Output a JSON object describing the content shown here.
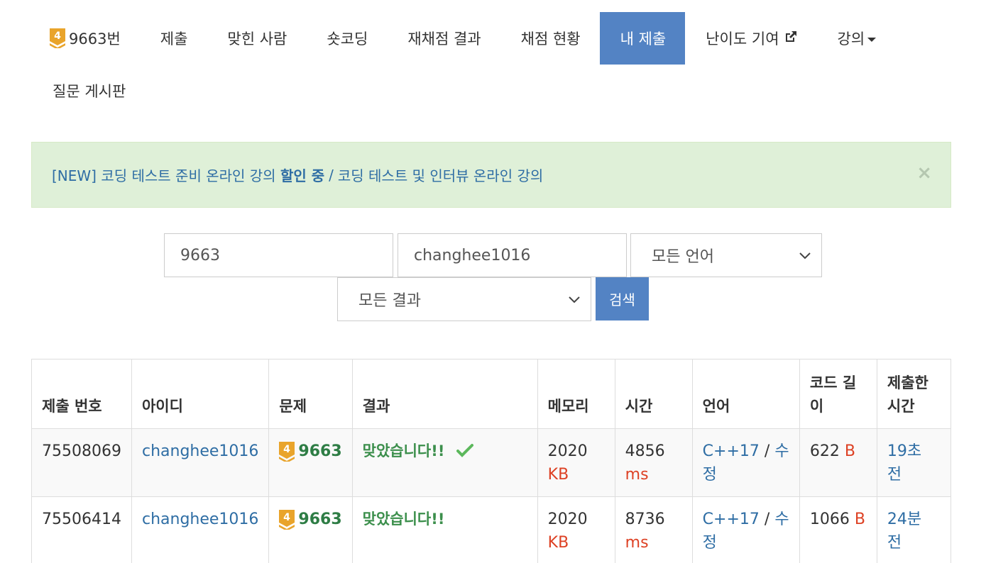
{
  "nav": {
    "problem": {
      "tier": "4",
      "label": "9663번"
    },
    "items": [
      {
        "label": "제출"
      },
      {
        "label": "맞힌 사람"
      },
      {
        "label": "숏코딩"
      },
      {
        "label": "재채점 결과"
      },
      {
        "label": "채점 현황"
      },
      {
        "label": "내 제출"
      },
      {
        "label": "난이도 기여"
      },
      {
        "label": "강의"
      }
    ],
    "second_row": [
      {
        "label": "질문 게시판"
      }
    ],
    "active": "내 제출"
  },
  "alert": {
    "link1": "[NEW] 코딩 테스트 준비 온라인 강의",
    "link1_strong": "할인 중",
    "separator": "/",
    "link2": "코딩 테스트 및 인터뷰 온라인 강의",
    "close": "×"
  },
  "search": {
    "problem_id": "9663",
    "user_id": "changhee1016",
    "language_select": "모든 언어",
    "result_select": "모든 결과",
    "button": "검색"
  },
  "table": {
    "headers": {
      "submission_id": "제출 번호",
      "user": "아이디",
      "problem": "문제",
      "result": "결과",
      "memory": "메모리",
      "time": "시간",
      "language": "언어",
      "code_length_1": "코드 길",
      "code_length_2": "이",
      "submitted_1": "제출한",
      "submitted_2": "시간"
    },
    "rows": [
      {
        "submission_id": "75508069",
        "user": "changhee1016",
        "tier": "4",
        "problem": "9663",
        "result": "맞았습니다!!",
        "memory": "2020",
        "memory_unit": "KB",
        "time": "4856",
        "time_unit": "ms",
        "language": "C++17",
        "lang_sep": "/",
        "edit_1": "수",
        "edit_2": "정",
        "code_length": "622",
        "code_unit": "B",
        "submitted": "19초 전"
      },
      {
        "submission_id": "75506414",
        "user": "changhee1016",
        "tier": "4",
        "problem": "9663",
        "result": "맞았습니다!!",
        "memory": "2020",
        "memory_unit": "KB",
        "time": "8736",
        "time_unit": "ms",
        "language": "C++17",
        "lang_sep": "/",
        "edit_1": "수",
        "edit_2": "정",
        "code_length": "1066",
        "code_unit": "B",
        "submitted": "24분 전"
      }
    ]
  },
  "colors": {
    "accent": "#5383c4",
    "link": "#2e6da4",
    "accepted": "#3c8f4c",
    "unit": "#dd4124",
    "alert_bg": "#dff0d8",
    "tier_gold": "#e9a42b"
  }
}
